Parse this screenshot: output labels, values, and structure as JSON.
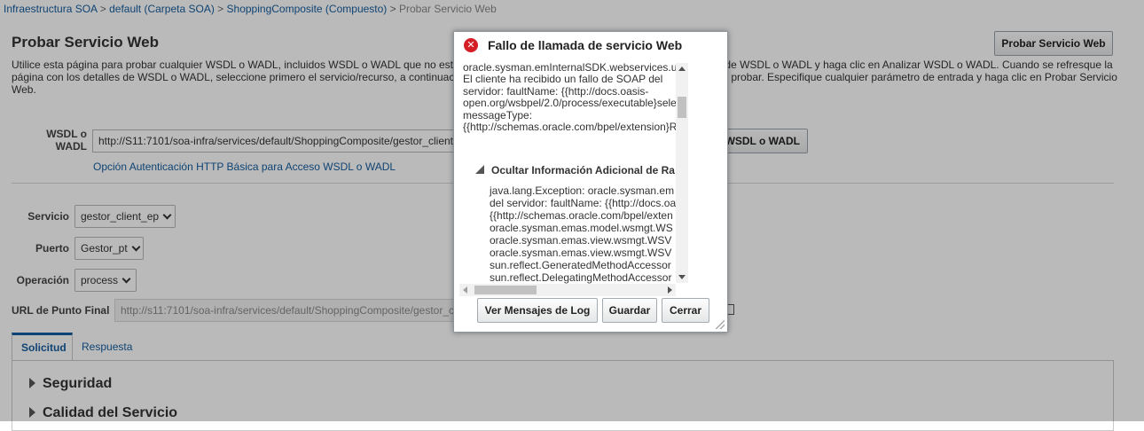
{
  "breadcrumb": {
    "items": [
      "Infraestructura SOA",
      "default (Carpeta SOA)",
      "ShoppingComposite (Compuesto)"
    ],
    "current": "Probar Servicio Web",
    "separator": ">"
  },
  "page": {
    "title": "Probar Servicio Web",
    "test_button": "Probar Servicio Web",
    "description": "Utilice esta página para probar cualquier WSDL o WADL, incluidos WSDL o WADL que no estén registrados en Enterprise Manager. Introduzca la URL de WSDL o WADL y haga clic en Analizar WSDL o WADL. Cuando se refresque la página con los detalles de WSDL o WADL, seleccione primero el servicio/recurso, a continuación el puerto/método y, por último, la operación que desea probar. Especifique cualquier parámetro de entrada y haga clic en Probar Servicio Web."
  },
  "form": {
    "wsdl_label": "WSDL o WADL",
    "wsdl_value": "http://S11:7101/soa-infra/services/default/ShoppingComposite/gestor_client_ep?WSDL",
    "parse_button": "WSDL o WADL",
    "auth_link": "Opción Autenticación HTTP Básica para Acceso WSDL o WADL",
    "service_label": "Servicio",
    "service_value": "gestor_client_ep",
    "port_label": "Puerto",
    "port_value": "Gestor_pt",
    "operation_label": "Operación",
    "operation_value": "process",
    "endpoint_label": "URL de Punto Final",
    "endpoint_value": "http://s11:7101/soa-infra/services/default/ShoppingComposite/gestor_client_ep"
  },
  "tabs": [
    {
      "label": "Solicitud",
      "active": true
    },
    {
      "label": "Respuesta",
      "active": false
    }
  ],
  "sections": [
    "Seguridad",
    "Calidad del Servicio"
  ],
  "dialog": {
    "title": "Fallo de llamada de servicio Web",
    "icon": "error-icon",
    "message_lines": [
      "oracle.sysman.emInternalSDK.webservices.u",
      "El cliente ha recibido un fallo de SOAP del",
      "servidor: faultName: {{http://docs.oasis-",
      "open.org/wsbpel/2.0/process/executable}sele",
      "messageType:",
      "{{http://schemas.oracle.com/bpel/extension}R"
    ],
    "additional_info_header": "Ocultar Información Adicional de Ra",
    "stack_lines": [
      "java.lang.Exception: oracle.sysman.em",
      "del servidor: faultName: {{http://docs.oa",
      "{{http://schemas.oracle.com/bpel/exten",
      "oracle.sysman.emas.model.wsmgt.WS",
      "oracle.sysman.emas.view.wsmgt.WSV",
      "oracle.sysman.emas.view.wsmgt.WSV",
      "sun.reflect.GeneratedMethodAccessor",
      "sun.reflect.DelegatingMethodAccessor"
    ],
    "buttons": {
      "view_log": "Ver Mensajes de Log",
      "save": "Guardar",
      "close": "Cerrar"
    }
  },
  "colors": {
    "link": "#145c9e",
    "error": "#d51f26",
    "overlay": "rgba(0,0,0,0.27)"
  }
}
